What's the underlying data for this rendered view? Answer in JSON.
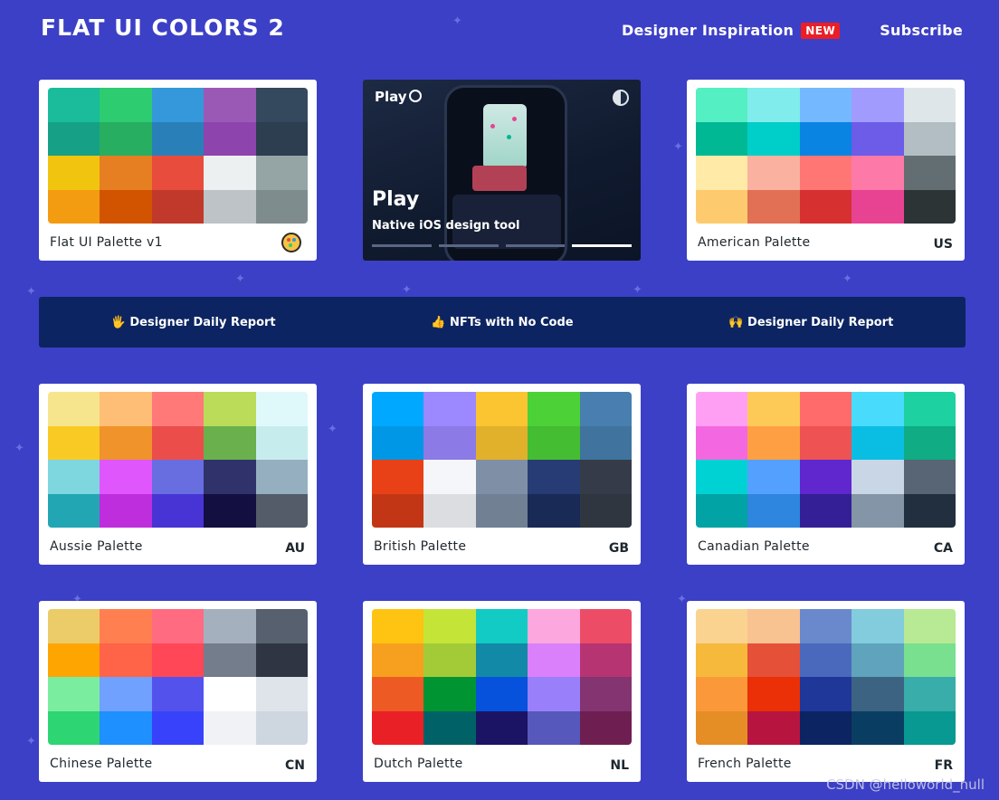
{
  "header": {
    "logo": "FLAT UI COLORS 2",
    "nav_inspiration": "Designer Inspiration",
    "nav_new_badge": "NEW",
    "nav_subscribe": "Subscribe"
  },
  "ad": {
    "brand": "Play",
    "title": "Play",
    "subtitle": "Native iOS design tool"
  },
  "banner": {
    "items": [
      "🖐 Designer Daily Report",
      "👍 NFTs with No Code",
      "🙌 Designer Daily Report"
    ]
  },
  "palettes": [
    {
      "name": "Flat UI Palette v1",
      "code": "",
      "emoji": "palette-icon",
      "colors": [
        "#1abc9c",
        "#2ecc71",
        "#3498db",
        "#9b59b6",
        "#34495e",
        "#16a085",
        "#27ae60",
        "#2980b9",
        "#8e44ad",
        "#2c3e50",
        "#f1c40f",
        "#e67e22",
        "#e74c3c",
        "#ecf0f1",
        "#95a5a6",
        "#f39c12",
        "#d35400",
        "#c0392b",
        "#bdc3c7",
        "#7f8c8d"
      ]
    },
    {
      "name": "American Palette",
      "code": "US",
      "colors": [
        "#55efc4",
        "#81ecec",
        "#74b9ff",
        "#a29bfe",
        "#dfe6e9",
        "#00b894",
        "#00cec9",
        "#0984e3",
        "#6c5ce7",
        "#b2bec3",
        "#ffeaa7",
        "#fab1a0",
        "#ff7675",
        "#fd79a8",
        "#636e72",
        "#fdcb6e",
        "#e17055",
        "#d63031",
        "#e84393",
        "#2d3436"
      ]
    },
    {
      "name": "Aussie Palette",
      "code": "AU",
      "colors": [
        "#f6e58d",
        "#ffbe76",
        "#ff7979",
        "#badc58",
        "#dff9fb",
        "#f9ca24",
        "#f0932b",
        "#eb4d4b",
        "#6ab04c",
        "#c7ecee",
        "#7ed6df",
        "#e056fd",
        "#686de0",
        "#30336b",
        "#95afc0",
        "#22a6b3",
        "#be2edd",
        "#4834d4",
        "#130f40",
        "#535c68"
      ]
    },
    {
      "name": "British Palette",
      "code": "GB",
      "colors": [
        "#00a8ff",
        "#9c88ff",
        "#fbc531",
        "#4cd137",
        "#487eb0",
        "#0097e6",
        "#8c7ae6",
        "#e1b12c",
        "#44bd32",
        "#40739e",
        "#e84118",
        "#f5f6fa",
        "#7f8fa6",
        "#273c75",
        "#353b48",
        "#c23616",
        "#dcdde1",
        "#718093",
        "#192a56",
        "#2f3640"
      ]
    },
    {
      "name": "Canadian Palette",
      "code": "CA",
      "colors": [
        "#ff9ff3",
        "#feca57",
        "#ff6b6b",
        "#48dbfb",
        "#1dd1a1",
        "#f368e0",
        "#ff9f43",
        "#ee5253",
        "#0abde3",
        "#10ac84",
        "#00d2d3",
        "#54a0ff",
        "#5f27cd",
        "#c8d6e5",
        "#576574",
        "#01a3a4",
        "#2e86de",
        "#341f97",
        "#8395a7",
        "#222f3e"
      ]
    },
    {
      "name": "Chinese Palette",
      "code": "CN",
      "colors": [
        "#eccc68",
        "#ff7f50",
        "#ff6b81",
        "#a4b0be",
        "#57606f",
        "#ffa502",
        "#ff6348",
        "#ff4757",
        "#747d8c",
        "#2f3542",
        "#7bed9f",
        "#70a1ff",
        "#5352ed",
        "#ffffff",
        "#dfe4ea",
        "#2ed573",
        "#1e90ff",
        "#3742fa",
        "#f1f2f6",
        "#ced6e0"
      ]
    },
    {
      "name": "Dutch Palette",
      "code": "NL",
      "colors": [
        "#ffc312",
        "#c4e538",
        "#12cbc4",
        "#fda7df",
        "#ed4c67",
        "#f79f1f",
        "#a3cb38",
        "#1289a7",
        "#d980fa",
        "#b53471",
        "#ee5a24",
        "#009432",
        "#0652dd",
        "#9980fa",
        "#833471",
        "#ea2027",
        "#006266",
        "#1b1464",
        "#5758bb",
        "#6f1e51"
      ]
    },
    {
      "name": "French Palette",
      "code": "FR",
      "colors": [
        "#fad390",
        "#f8c291",
        "#6a89cc",
        "#82ccdd",
        "#b8e994",
        "#f6b93b",
        "#e55039",
        "#4a69bd",
        "#60a3bc",
        "#78e08f",
        "#fa983a",
        "#eb2f06",
        "#1e3799",
        "#3c6382",
        "#38ada9",
        "#e58e26",
        "#b71540",
        "#0c2461",
        "#0a3d62",
        "#079992"
      ]
    }
  ],
  "watermark": "CSDN @helloworld_null"
}
